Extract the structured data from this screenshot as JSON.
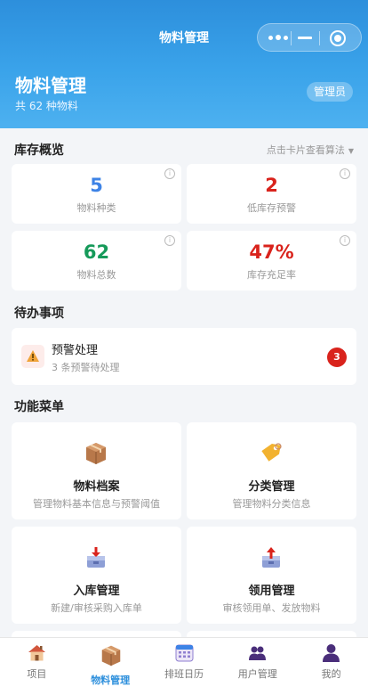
{
  "nav": {
    "title": "物料管理"
  },
  "header": {
    "title": "物料管理",
    "subtitle": "共 62 种物料",
    "role": "管理员"
  },
  "overview": {
    "title": "库存概览",
    "hint": "点击卡片查看算法",
    "stats": [
      {
        "value": "5",
        "label": "物料种类",
        "color": "#3d83e6"
      },
      {
        "value": "2",
        "label": "低库存预警",
        "color": "#d9231c"
      },
      {
        "value": "62",
        "label": "物料总数",
        "color": "#169a5a"
      },
      {
        "value": "47%",
        "label": "库存充足率",
        "color": "#d9231c"
      }
    ],
    "info_glyph": "i"
  },
  "todo": {
    "title": "待办事项",
    "item": {
      "title": "预警处理",
      "subtitle": "3 条预警待处理",
      "count": "3",
      "icon": "warning-icon"
    }
  },
  "menu": {
    "title": "功能菜单",
    "items": [
      {
        "title": "物料档案",
        "desc": "管理物料基本信息与预警阈值",
        "icon": "package-icon"
      },
      {
        "title": "分类管理",
        "desc": "管理物料分类信息",
        "icon": "tag-icon"
      },
      {
        "title": "入库管理",
        "desc": "新建/审核采购入库单",
        "icon": "inbox-in-icon"
      },
      {
        "title": "领用管理",
        "desc": "审核领用单、发放物料",
        "icon": "outbox-icon"
      }
    ]
  },
  "tabs": [
    {
      "label": "项目",
      "icon": "house-icon"
    },
    {
      "label": "物料管理",
      "icon": "package-icon",
      "active": true
    },
    {
      "label": "排班日历",
      "icon": "calendar-icon"
    },
    {
      "label": "用户管理",
      "icon": "users-icon"
    },
    {
      "label": "我的",
      "icon": "person-icon"
    }
  ],
  "colors": {
    "primary": "#2d8fdc",
    "danger": "#d9231c",
    "success": "#169a5a",
    "blue": "#3d83e6"
  }
}
